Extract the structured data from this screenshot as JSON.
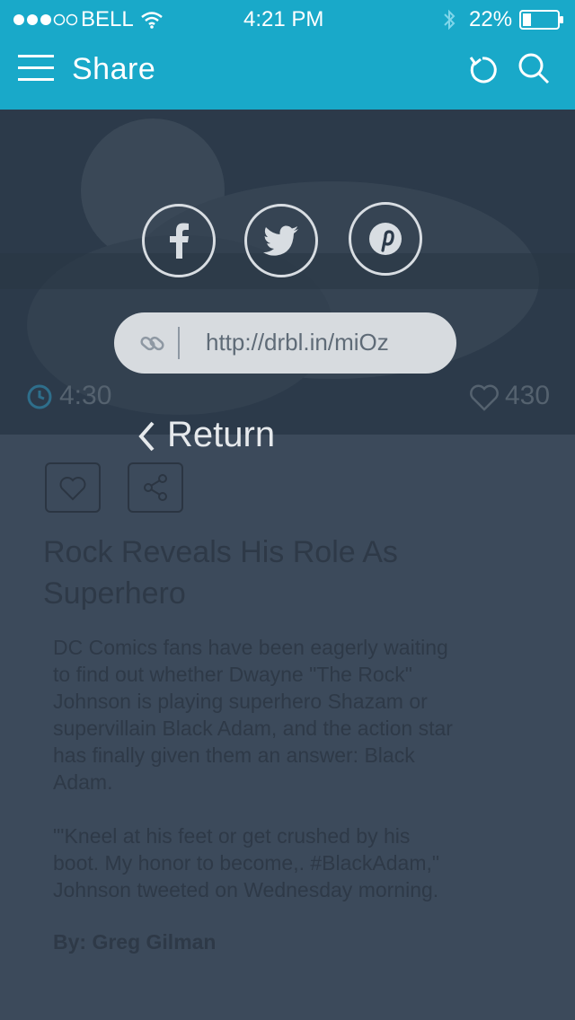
{
  "status_bar": {
    "carrier": "BELL",
    "time": "4:21 PM",
    "battery": "22%",
    "icons": [
      "signal-dots-icon",
      "wifi-icon",
      "bluetooth-icon",
      "battery-icon"
    ]
  },
  "header": {
    "title": "Share",
    "icons": [
      "menu-icon",
      "refresh-icon",
      "search-icon"
    ]
  },
  "share": {
    "buttons": [
      "facebook",
      "twitter",
      "pinterest"
    ],
    "link_url": "http://drbl.in/miOz",
    "return_label": "Return"
  },
  "article": {
    "time": "4:30",
    "likes": "430",
    "title_line1": "Rock Reveals His Role As",
    "title_line2": "Superhero",
    "body_lines_p1": [
      "DC Comics fans have been eagerly waiting",
      "to find out whether Dwayne \"The Rock\"",
      "Johnson is playing superhero Shazam or",
      "supervillain Black Adam, and the action star",
      "has finally given them an answer: Black",
      "Adam."
    ],
    "body_lines_p2": [
      "\"'Kneel at his feet or get crushed by his",
      "boot. My honor to become,. #BlackAdam,\"",
      "Johnson tweeted on Wednesday morning."
    ],
    "byline": "By: Greg Gilman"
  },
  "colors": {
    "header_bg": "#19a9c9",
    "overlay_bg": "#3c4a5b",
    "hero_bg": "#2c3a4a",
    "pill_bg": "#d7dbdf"
  }
}
